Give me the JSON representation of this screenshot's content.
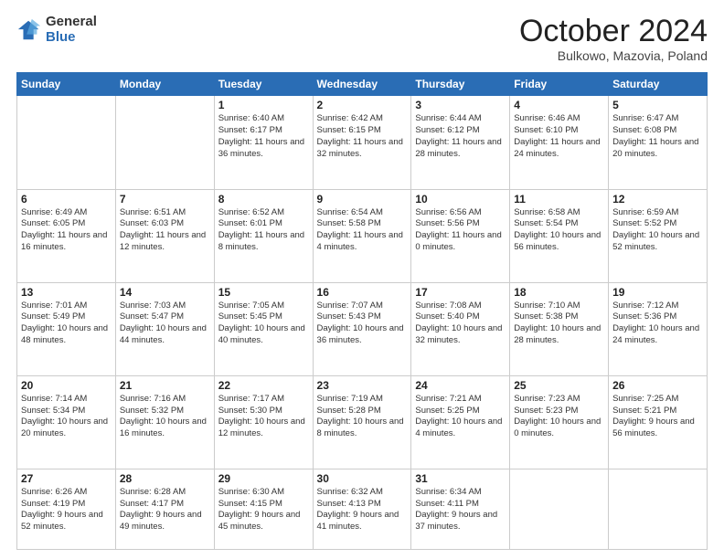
{
  "logo": {
    "general": "General",
    "blue": "Blue"
  },
  "header": {
    "month": "October 2024",
    "location": "Bulkowo, Mazovia, Poland"
  },
  "weekdays": [
    "Sunday",
    "Monday",
    "Tuesday",
    "Wednesday",
    "Thursday",
    "Friday",
    "Saturday"
  ],
  "weeks": [
    [
      {
        "day": "",
        "sunrise": "",
        "sunset": "",
        "daylight": ""
      },
      {
        "day": "",
        "sunrise": "",
        "sunset": "",
        "daylight": ""
      },
      {
        "day": "1",
        "sunrise": "Sunrise: 6:40 AM",
        "sunset": "Sunset: 6:17 PM",
        "daylight": "Daylight: 11 hours and 36 minutes."
      },
      {
        "day": "2",
        "sunrise": "Sunrise: 6:42 AM",
        "sunset": "Sunset: 6:15 PM",
        "daylight": "Daylight: 11 hours and 32 minutes."
      },
      {
        "day": "3",
        "sunrise": "Sunrise: 6:44 AM",
        "sunset": "Sunset: 6:12 PM",
        "daylight": "Daylight: 11 hours and 28 minutes."
      },
      {
        "day": "4",
        "sunrise": "Sunrise: 6:46 AM",
        "sunset": "Sunset: 6:10 PM",
        "daylight": "Daylight: 11 hours and 24 minutes."
      },
      {
        "day": "5",
        "sunrise": "Sunrise: 6:47 AM",
        "sunset": "Sunset: 6:08 PM",
        "daylight": "Daylight: 11 hours and 20 minutes."
      }
    ],
    [
      {
        "day": "6",
        "sunrise": "Sunrise: 6:49 AM",
        "sunset": "Sunset: 6:05 PM",
        "daylight": "Daylight: 11 hours and 16 minutes."
      },
      {
        "day": "7",
        "sunrise": "Sunrise: 6:51 AM",
        "sunset": "Sunset: 6:03 PM",
        "daylight": "Daylight: 11 hours and 12 minutes."
      },
      {
        "day": "8",
        "sunrise": "Sunrise: 6:52 AM",
        "sunset": "Sunset: 6:01 PM",
        "daylight": "Daylight: 11 hours and 8 minutes."
      },
      {
        "day": "9",
        "sunrise": "Sunrise: 6:54 AM",
        "sunset": "Sunset: 5:58 PM",
        "daylight": "Daylight: 11 hours and 4 minutes."
      },
      {
        "day": "10",
        "sunrise": "Sunrise: 6:56 AM",
        "sunset": "Sunset: 5:56 PM",
        "daylight": "Daylight: 11 hours and 0 minutes."
      },
      {
        "day": "11",
        "sunrise": "Sunrise: 6:58 AM",
        "sunset": "Sunset: 5:54 PM",
        "daylight": "Daylight: 10 hours and 56 minutes."
      },
      {
        "day": "12",
        "sunrise": "Sunrise: 6:59 AM",
        "sunset": "Sunset: 5:52 PM",
        "daylight": "Daylight: 10 hours and 52 minutes."
      }
    ],
    [
      {
        "day": "13",
        "sunrise": "Sunrise: 7:01 AM",
        "sunset": "Sunset: 5:49 PM",
        "daylight": "Daylight: 10 hours and 48 minutes."
      },
      {
        "day": "14",
        "sunrise": "Sunrise: 7:03 AM",
        "sunset": "Sunset: 5:47 PM",
        "daylight": "Daylight: 10 hours and 44 minutes."
      },
      {
        "day": "15",
        "sunrise": "Sunrise: 7:05 AM",
        "sunset": "Sunset: 5:45 PM",
        "daylight": "Daylight: 10 hours and 40 minutes."
      },
      {
        "day": "16",
        "sunrise": "Sunrise: 7:07 AM",
        "sunset": "Sunset: 5:43 PM",
        "daylight": "Daylight: 10 hours and 36 minutes."
      },
      {
        "day": "17",
        "sunrise": "Sunrise: 7:08 AM",
        "sunset": "Sunset: 5:40 PM",
        "daylight": "Daylight: 10 hours and 32 minutes."
      },
      {
        "day": "18",
        "sunrise": "Sunrise: 7:10 AM",
        "sunset": "Sunset: 5:38 PM",
        "daylight": "Daylight: 10 hours and 28 minutes."
      },
      {
        "day": "19",
        "sunrise": "Sunrise: 7:12 AM",
        "sunset": "Sunset: 5:36 PM",
        "daylight": "Daylight: 10 hours and 24 minutes."
      }
    ],
    [
      {
        "day": "20",
        "sunrise": "Sunrise: 7:14 AM",
        "sunset": "Sunset: 5:34 PM",
        "daylight": "Daylight: 10 hours and 20 minutes."
      },
      {
        "day": "21",
        "sunrise": "Sunrise: 7:16 AM",
        "sunset": "Sunset: 5:32 PM",
        "daylight": "Daylight: 10 hours and 16 minutes."
      },
      {
        "day": "22",
        "sunrise": "Sunrise: 7:17 AM",
        "sunset": "Sunset: 5:30 PM",
        "daylight": "Daylight: 10 hours and 12 minutes."
      },
      {
        "day": "23",
        "sunrise": "Sunrise: 7:19 AM",
        "sunset": "Sunset: 5:28 PM",
        "daylight": "Daylight: 10 hours and 8 minutes."
      },
      {
        "day": "24",
        "sunrise": "Sunrise: 7:21 AM",
        "sunset": "Sunset: 5:25 PM",
        "daylight": "Daylight: 10 hours and 4 minutes."
      },
      {
        "day": "25",
        "sunrise": "Sunrise: 7:23 AM",
        "sunset": "Sunset: 5:23 PM",
        "daylight": "Daylight: 10 hours and 0 minutes."
      },
      {
        "day": "26",
        "sunrise": "Sunrise: 7:25 AM",
        "sunset": "Sunset: 5:21 PM",
        "daylight": "Daylight: 9 hours and 56 minutes."
      }
    ],
    [
      {
        "day": "27",
        "sunrise": "Sunrise: 6:26 AM",
        "sunset": "Sunset: 4:19 PM",
        "daylight": "Daylight: 9 hours and 52 minutes."
      },
      {
        "day": "28",
        "sunrise": "Sunrise: 6:28 AM",
        "sunset": "Sunset: 4:17 PM",
        "daylight": "Daylight: 9 hours and 49 minutes."
      },
      {
        "day": "29",
        "sunrise": "Sunrise: 6:30 AM",
        "sunset": "Sunset: 4:15 PM",
        "daylight": "Daylight: 9 hours and 45 minutes."
      },
      {
        "day": "30",
        "sunrise": "Sunrise: 6:32 AM",
        "sunset": "Sunset: 4:13 PM",
        "daylight": "Daylight: 9 hours and 41 minutes."
      },
      {
        "day": "31",
        "sunrise": "Sunrise: 6:34 AM",
        "sunset": "Sunset: 4:11 PM",
        "daylight": "Daylight: 9 hours and 37 minutes."
      },
      {
        "day": "",
        "sunrise": "",
        "sunset": "",
        "daylight": ""
      },
      {
        "day": "",
        "sunrise": "",
        "sunset": "",
        "daylight": ""
      }
    ]
  ]
}
